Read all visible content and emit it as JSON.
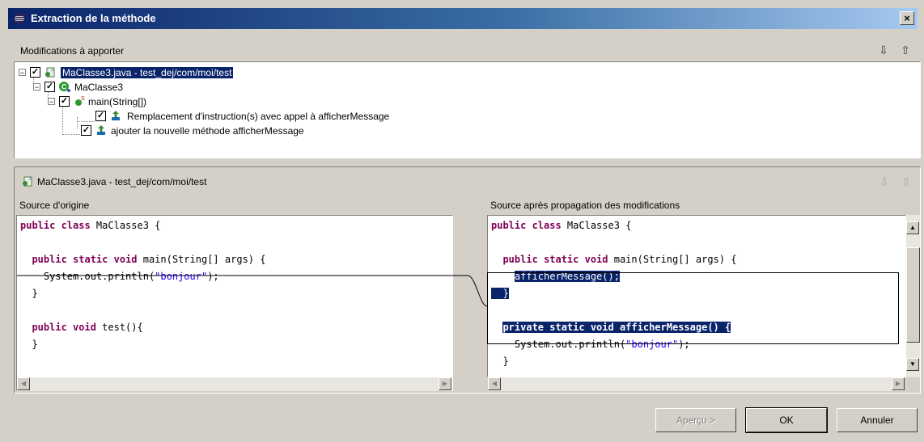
{
  "window": {
    "title": "Extraction de la méthode",
    "close_label": "×"
  },
  "modifications": {
    "header": "Modifications à apporter",
    "tree": [
      {
        "label": "MaClasse3.java - test_dej/com/moi/test",
        "expander": "−",
        "checked": true,
        "icon": "java-file-icon"
      },
      {
        "label": "MaClasse3",
        "expander": "−",
        "checked": true,
        "icon": "class-icon"
      },
      {
        "label": "main(String[])",
        "expander": "−",
        "checked": true,
        "icon": "method-icon"
      },
      {
        "label": "Remplacement d'instruction(s) avec appel à afficherMessage",
        "checked": true,
        "icon": "change-icon"
      },
      {
        "label": "ajouter la nouvelle méthode afficherMessage",
        "checked": true,
        "icon": "change-icon"
      }
    ]
  },
  "compare": {
    "file_label": "MaClasse3.java - test_dej/com/moi/test",
    "left_title": "Source d'origine",
    "right_title": "Source après propagation des modifications",
    "left_code": [
      [
        {
          "t": "public class",
          "c": "kw"
        },
        {
          "t": " MaClasse3 {"
        }
      ],
      [],
      [
        {
          "t": "  "
        },
        {
          "t": "public static void",
          "c": "kw"
        },
        {
          "t": " main(String[] args) {"
        }
      ],
      [
        {
          "t": "    System.out.println("
        },
        {
          "t": "\"bonjour\"",
          "c": "str"
        },
        {
          "t": ");"
        }
      ],
      [
        {
          "t": "  }"
        }
      ],
      [],
      [
        {
          "t": "  "
        },
        {
          "t": "public void",
          "c": "kw"
        },
        {
          "t": " test(){"
        }
      ],
      [
        {
          "t": "  }"
        }
      ]
    ],
    "right_code": [
      [
        {
          "t": "public class",
          "c": "kw"
        },
        {
          "t": " MaClasse3 {"
        }
      ],
      [],
      [
        {
          "t": "  "
        },
        {
          "t": "public static void",
          "c": "kw"
        },
        {
          "t": " main(String[] args) {"
        }
      ],
      [
        {
          "t": "    "
        },
        {
          "t": "afficherMessage();",
          "c": "hl"
        }
      ],
      [
        {
          "t": "  }",
          "c": "hl"
        }
      ],
      [],
      [
        {
          "t": "  "
        },
        {
          "t": "private static void afficherMessage() {",
          "c": "hlkw"
        }
      ],
      [
        {
          "t": "    System.out.println("
        },
        {
          "t": "\"bonjour\"",
          "c": "str"
        },
        {
          "t": ");"
        }
      ],
      [
        {
          "t": "  }"
        }
      ]
    ]
  },
  "buttons": {
    "preview": "Aperçu >",
    "ok": "OK",
    "cancel": "Annuler"
  }
}
